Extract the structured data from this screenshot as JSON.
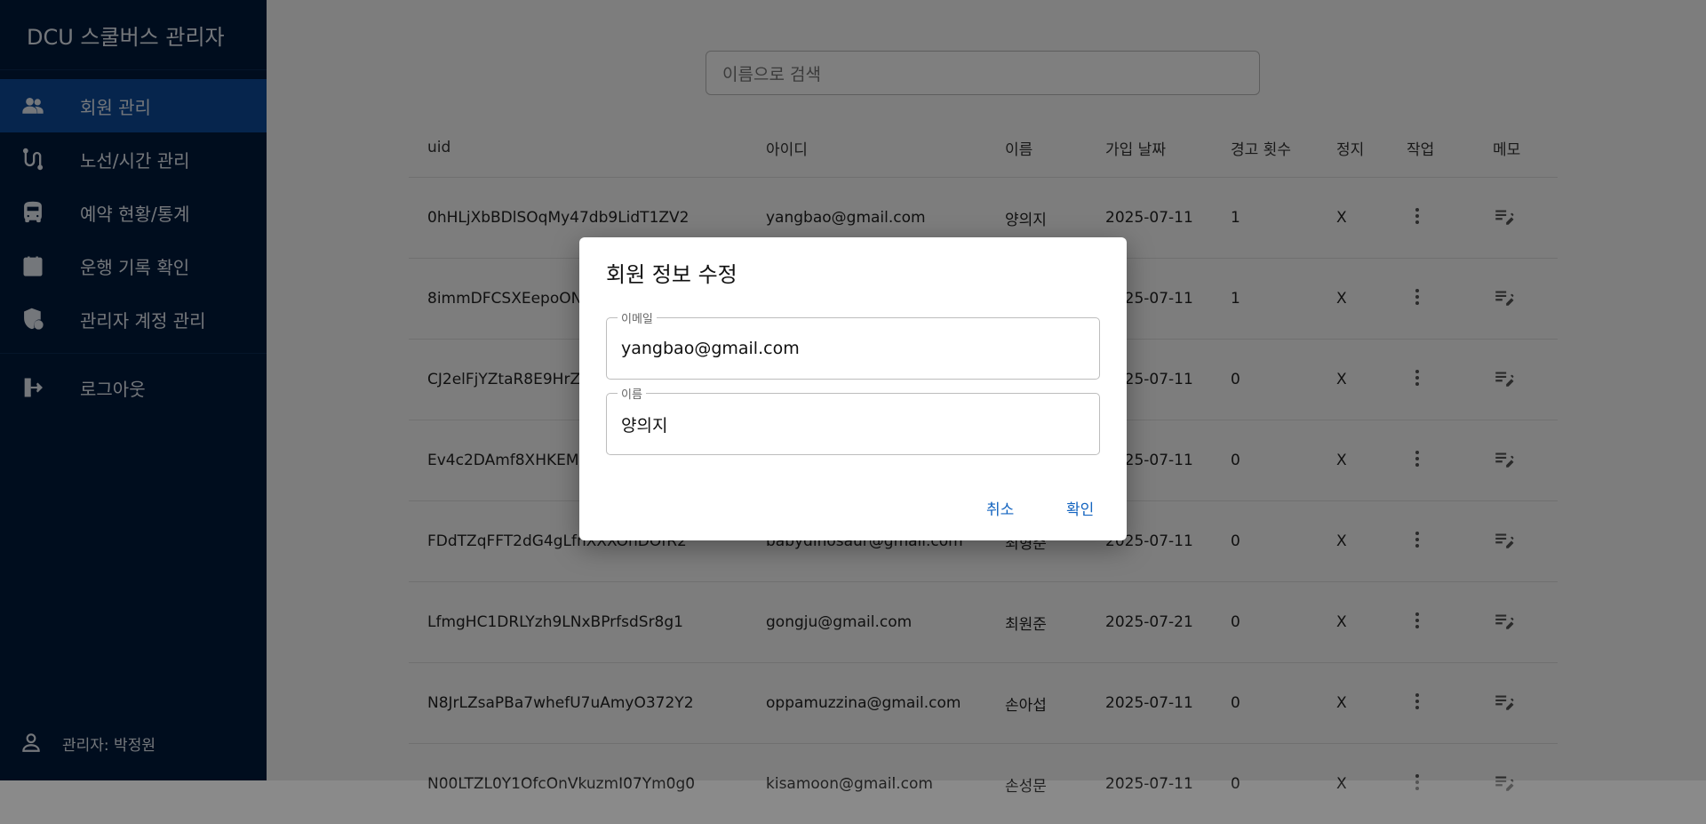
{
  "sidebar": {
    "brand": "DCU 스쿨버스 관리자",
    "items": [
      {
        "label": "회원 관리",
        "icon": "users-icon"
      },
      {
        "label": "노선/시간 관리",
        "icon": "route-icon"
      },
      {
        "label": "예약 현황/통계",
        "icon": "bus-icon"
      },
      {
        "label": "운행 기록 확인",
        "icon": "calendar-icon"
      },
      {
        "label": "관리자 계정 관리",
        "icon": "admin-shield-icon"
      }
    ],
    "logout": {
      "label": "로그아웃",
      "icon": "logout-icon"
    },
    "footer": {
      "label": "관리자: 박정원",
      "icon": "person-icon"
    }
  },
  "search": {
    "placeholder": "이름으로 검색"
  },
  "table": {
    "columns": [
      "uid",
      "아이디",
      "이름",
      "가입 날짜",
      "경고 횟수",
      "정지",
      "작업",
      "메모"
    ],
    "rows": [
      {
        "uid": "0hHLjXbBDlSOqMy47db9LidT1ZV2",
        "id": "yangbao@gmail.com",
        "name": "양의지",
        "date": "2025-07-11",
        "warn": "1",
        "stop": "X"
      },
      {
        "uid": "8immDFCSXEepoON",
        "id": "",
        "name": "",
        "date": "2025-07-11",
        "warn": "1",
        "stop": "X"
      },
      {
        "uid": "CJ2elFjYZtaR8E9HrZ",
        "id": "",
        "name": "",
        "date": "2025-07-11",
        "warn": "0",
        "stop": "X"
      },
      {
        "uid": "Ev4c2DAmf8XHKEM",
        "id": "",
        "name": "",
        "date": "2025-07-11",
        "warn": "0",
        "stop": "X"
      },
      {
        "uid": "FDdTZqFFT2dG4gLfnXXXOnDOfR2",
        "id": "babydinosaur@gmail.com",
        "name": "최형준",
        "date": "2025-07-11",
        "warn": "0",
        "stop": "X"
      },
      {
        "uid": "LfmgHC1DRLYzh9LNxBPrfsdSr8g1",
        "id": "gongju@gmail.com",
        "name": "최원준",
        "date": "2025-07-21",
        "warn": "0",
        "stop": "X"
      },
      {
        "uid": "N8JrLZsaPBa7whefU7uAmyO372Y2",
        "id": "oppamuzzina@gmail.com",
        "name": "손아섭",
        "date": "2025-07-11",
        "warn": "0",
        "stop": "X"
      },
      {
        "uid": "N00LTZL0Y1OfcOnVkuzmI07Ym0g0",
        "id": "kisamoon@gmail.com",
        "name": "손성문",
        "date": "2025-07-11",
        "warn": "0",
        "stop": "X"
      }
    ]
  },
  "dialog": {
    "title": "회원 정보 수정",
    "email_label": "이메일",
    "email_value": "yangbao@gmail.com",
    "name_label": "이름",
    "name_value": "양의지",
    "cancel": "취소",
    "confirm": "확인"
  },
  "colors": {
    "sidebar_bg": "#001a3d",
    "active_item": "#0c4a9a",
    "accent": "#1565c0"
  }
}
